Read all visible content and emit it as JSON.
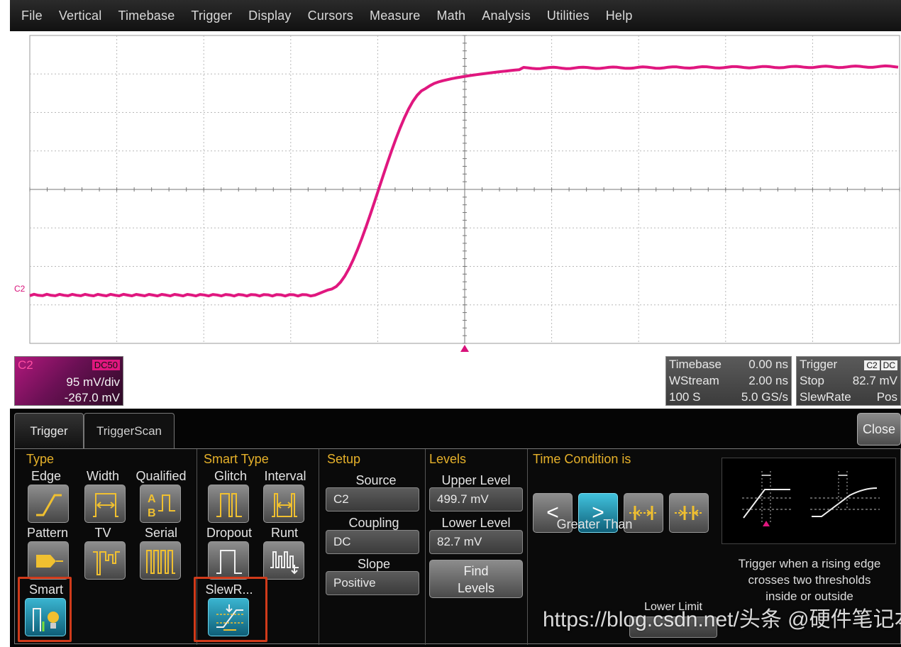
{
  "menu": [
    "File",
    "Vertical",
    "Timebase",
    "Trigger",
    "Display",
    "Cursors",
    "Measure",
    "Math",
    "Analysis",
    "Utilities",
    "Help"
  ],
  "colors": {
    "trace": "#e0177f",
    "section_title": "#e6b12a",
    "selected": "#1f8fb0",
    "highlight": "#d03a1a"
  },
  "waveform": {
    "channel_label": "C2",
    "description": "rising edge, low level then fast rise then high level"
  },
  "channel": {
    "name": "C2",
    "coupling": "DC50",
    "vdiv": "95 mV/div",
    "offset": "-267.0 mV"
  },
  "timebase": {
    "title": "Timebase",
    "delay": "0.00 ns",
    "mode": "WStream",
    "tdiv": "2.00 ns",
    "samples": "100 S",
    "rate": "5.0 GS/s"
  },
  "trigger_info": {
    "title": "Trigger",
    "tag1": "C2",
    "tag2": "DC",
    "state": "Stop",
    "level": "82.7 mV",
    "type": "SlewRate",
    "slope": "Pos"
  },
  "tabs": [
    "Trigger",
    "TriggerScan"
  ],
  "close_label": "Close",
  "type_section": {
    "title": "Type",
    "items": [
      "Edge",
      "Width",
      "Qualified",
      "Pattern",
      "TV",
      "Serial",
      "Smart"
    ]
  },
  "smart_type_section": {
    "title": "Smart Type",
    "items": [
      "Glitch",
      "Interval",
      "Dropout",
      "Runt",
      "SlewR..."
    ]
  },
  "setup": {
    "title": "Setup",
    "source_label": "Source",
    "source_value": "C2",
    "coupling_label": "Coupling",
    "coupling_value": "DC",
    "slope_label": "Slope",
    "slope_value": "Positive"
  },
  "levels": {
    "title": "Levels",
    "upper_label": "Upper Level",
    "upper_value": "499.7 mV",
    "lower_label": "Lower Level",
    "lower_value": "82.7 mV",
    "find_line1": "Find",
    "find_line2": "Levels"
  },
  "time_condition": {
    "title": "Time Condition is",
    "buttons": [
      "<",
      ">"
    ],
    "selected_label": "Greater Than",
    "description_line1": "Trigger when a rising edge",
    "description_line2": "crosses two thresholds",
    "description_line3": "inside or outside",
    "lower_limit_label": "Lower Limit"
  },
  "watermark": "https://blog.csdn.net/头条 @硬件笔记本"
}
